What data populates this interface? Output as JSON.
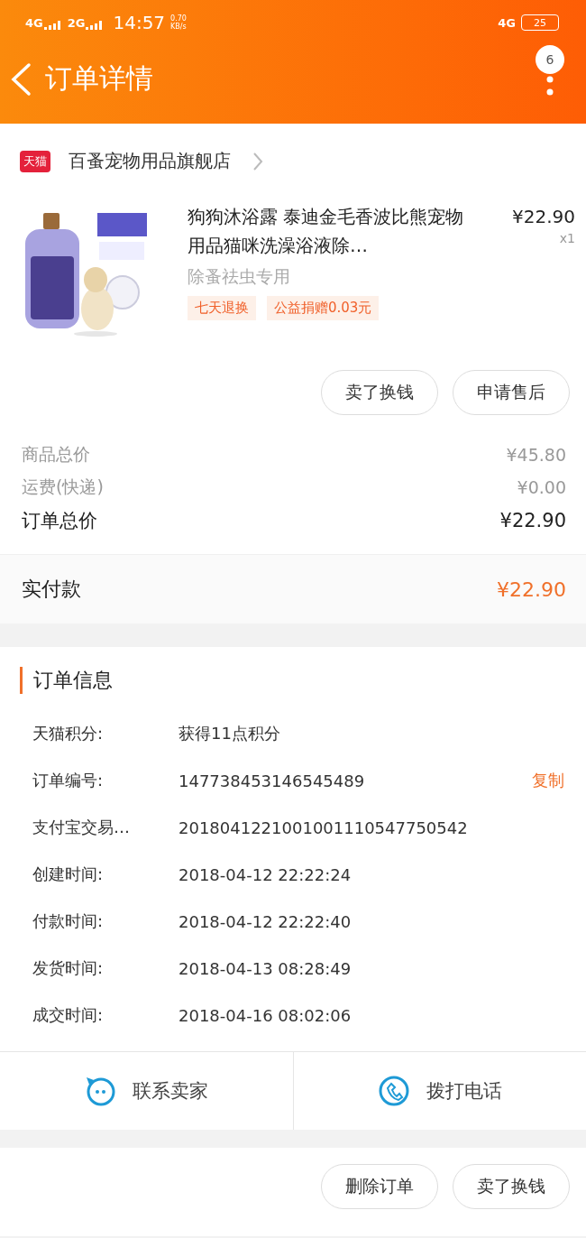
{
  "status_bar": {
    "network_1": "4G",
    "network_2": "2G",
    "time": "14:57",
    "speed": "0.70",
    "speed_unit": "KB/s",
    "network_3": "4G",
    "battery": "25"
  },
  "header": {
    "title": "订单详情",
    "badge": "6"
  },
  "store": {
    "badge": "天猫",
    "name": "百蚤宠物用品旗舰店"
  },
  "product": {
    "title": "狗狗沐浴露 泰迪金毛香波比熊宠物用品猫咪洗澡浴液除…",
    "price": "¥22.90",
    "quantity": "x1",
    "spec": "除蚤祛虫专用",
    "tags": [
      "七天退换",
      "公益捐赠0.03元"
    ]
  },
  "item_actions": [
    "卖了换钱",
    "申请售后"
  ],
  "price_rows": [
    {
      "kind": "sub",
      "label": "商品总价",
      "value": "¥45.80"
    },
    {
      "kind": "sub",
      "label": "运费(快递)",
      "value": "¥0.00"
    },
    {
      "kind": "total",
      "label": "订单总价",
      "value": "¥22.90"
    },
    {
      "kind": "paid",
      "label": "实付款",
      "value": "¥22.90"
    }
  ],
  "order_info": {
    "title": "订单信息",
    "rows": [
      {
        "label": "天猫积分:",
        "value": "获得11点积分"
      },
      {
        "label": "订单编号:",
        "value": "147738453146545489",
        "action": "复制"
      },
      {
        "label": "支付宝交易…",
        "value": "2018041221001001110547750542"
      },
      {
        "label": "创建时间:",
        "value": "2018-04-12 22:22:24"
      },
      {
        "label": "付款时间:",
        "value": "2018-04-12 22:22:40"
      },
      {
        "label": "发货时间:",
        "value": "2018-04-13 08:28:49"
      },
      {
        "label": "成交时间:",
        "value": "2018-04-16 08:02:06"
      }
    ]
  },
  "contact": [
    {
      "kind": "chat",
      "label": "联系卖家"
    },
    {
      "kind": "phone",
      "label": "拨打电话"
    }
  ],
  "footer_actions": [
    "删除订单",
    "卖了换钱"
  ]
}
